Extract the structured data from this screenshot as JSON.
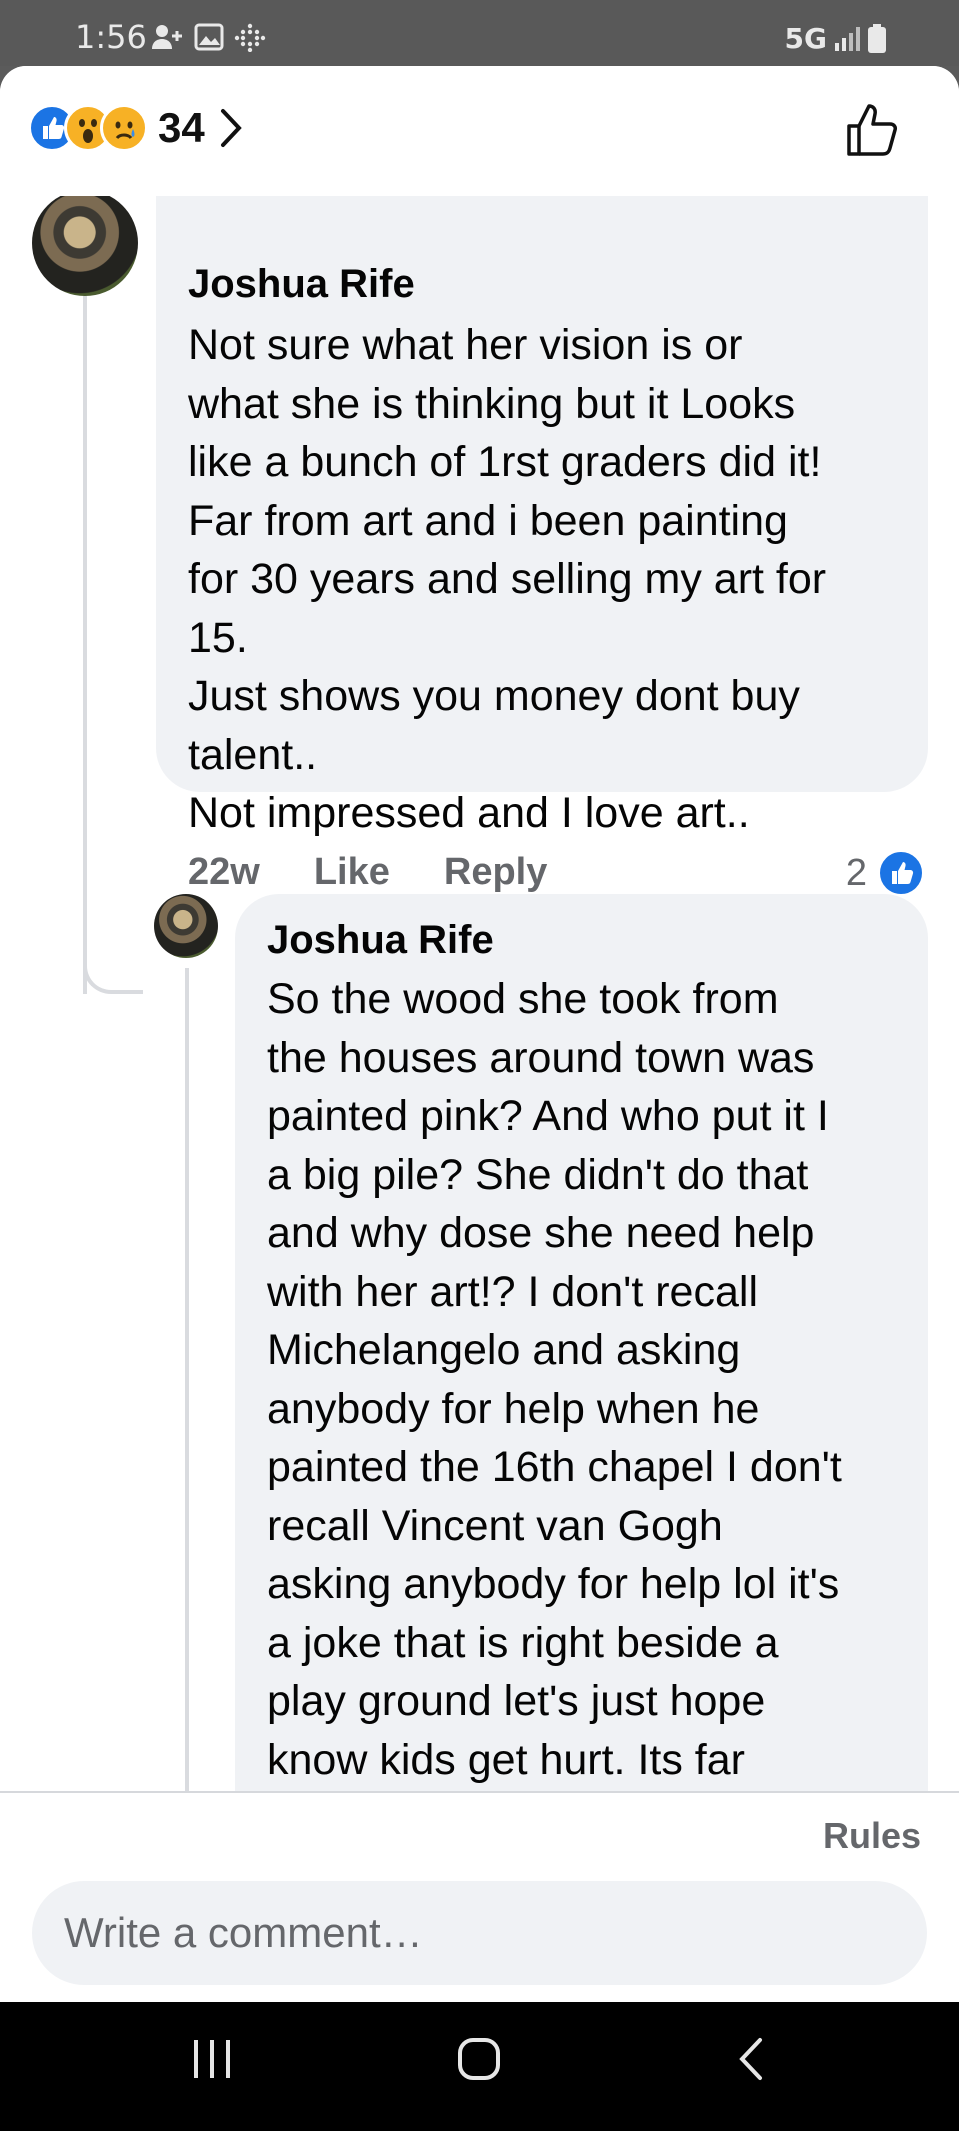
{
  "status_bar": {
    "time": "1:56",
    "network": "5G"
  },
  "reactions": {
    "types": [
      "like-icon",
      "wow-icon",
      "sad-icon"
    ],
    "count": "34"
  },
  "comments": [
    {
      "author": "Joshua Rife",
      "text": "Not sure what her vision is or\nwhat she is thinking but it Looks\nlike a bunch of 1rst graders did it!\nFar from art and i been painting\nfor 30 years and selling my art for\n15.\nJust shows you money dont buy\ntalent..\nNot impressed and I love art..",
      "age": "22w",
      "like_label": "Like",
      "reply_label": "Reply",
      "like_count": "2"
    },
    {
      "author": "Joshua Rife",
      "text": "So the wood she took from\nthe houses around town was\npainted pink? And who put it I\na big pile? She didn't do that\nand why dose she need help\nwith her art!? I don't recall\nMichelangelo and asking\nanybody for help when he\npainted the 16th chapel I don't\nrecall Vincent van Gogh\nasking anybody for help lol it's\na joke that is right beside a\nplay ground let's just hope\nknow kids get hurt. Its far"
    }
  ],
  "footer": {
    "rules_label": "Rules",
    "compose_placeholder": "Write a comment…"
  },
  "colors": {
    "accent": "#1b74e4",
    "bubble": "#f0f2f5",
    "meta_text": "#65676b"
  }
}
